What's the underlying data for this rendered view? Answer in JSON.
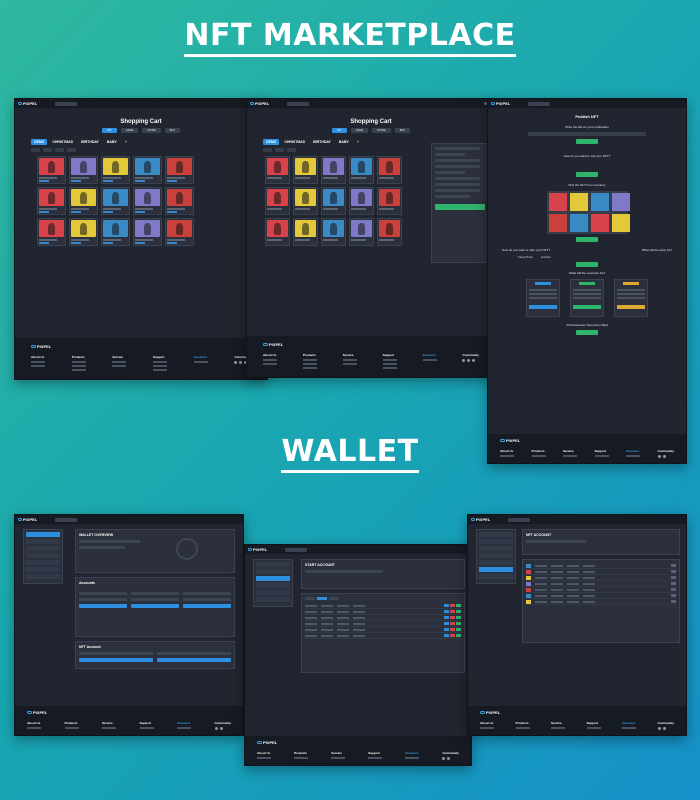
{
  "headings": {
    "nft_marketplace": "NFT MARKETPLACE",
    "wallet": "WALLET"
  },
  "brand": {
    "name": "PIXPEL",
    "accent": "#2c8fe0",
    "green": "#2fb46b"
  },
  "cart": {
    "title": "Shopping Cart",
    "filters": [
      "NFT",
      "GAME",
      "STORE",
      "BOX"
    ],
    "tabs": [
      "GEMS",
      "CHRISTMAS",
      "BIRTHDAY",
      "BABY",
      "+"
    ]
  },
  "publish": {
    "title": "Publish NFT",
    "q1": "Write the title for your publication",
    "q2": "How do you want to sell your NFT?",
    "q3": "Pick the NFT from inventory",
    "q4": "How do you want to offer your NFT?",
    "q4_options": [
      "Fixed Price",
      "Auction"
    ],
    "q5": "What will the price be?",
    "q6": "What will the exposure be?",
    "done": "All Parameters have been filled"
  },
  "wallet": {
    "overview": "WALLET OVERVIEW",
    "accounts": "Accounts",
    "nft_account": "NFT Account",
    "start_account": "START ACCOUNT",
    "nft_account_upper": "NFT ACCOUNT"
  },
  "footer": {
    "columns": [
      "About Us",
      "Products",
      "Service",
      "Support",
      "Investors",
      "Community"
    ]
  }
}
